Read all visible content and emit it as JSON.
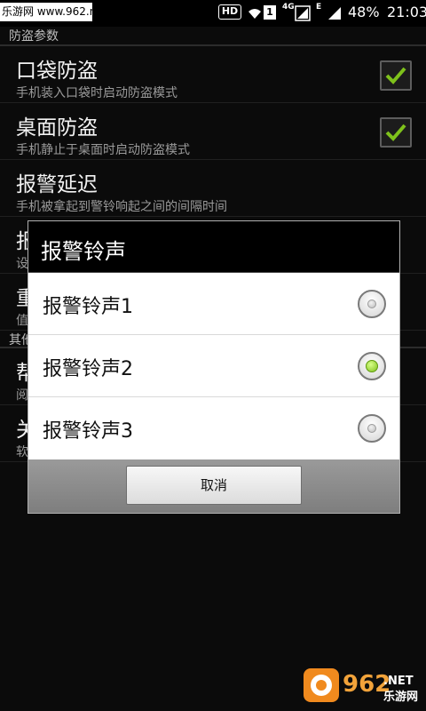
{
  "status_bar": {
    "site": "乐游网 www.962.net",
    "hd": "HD",
    "sim_badge": "1",
    "network_4g": "4G",
    "network_e": "E",
    "battery": "48%",
    "time": "21:03"
  },
  "settings": {
    "section_antitheft": "防盗参数",
    "items": [
      {
        "title": "口袋防盗",
        "summary": "手机装入口袋时启动防盗模式",
        "checked": true
      },
      {
        "title": "桌面防盗",
        "summary": "手机静止于桌面时启动防盗模式",
        "checked": true
      },
      {
        "title": "报警延迟",
        "summary": "手机被拿起到警铃响起之间的间隔时间"
      },
      {
        "title": "报",
        "summary": "设"
      },
      {
        "title": "重",
        "summary": "值"
      }
    ],
    "section_other": "其他",
    "other_items": [
      {
        "title": "帮",
        "summary": "阅"
      },
      {
        "title": "关",
        "summary": "软"
      }
    ]
  },
  "dialog": {
    "title": "报警铃声",
    "options": [
      {
        "label": "报警铃声1",
        "selected": false
      },
      {
        "label": "报警铃声2",
        "selected": true
      },
      {
        "label": "报警铃声3",
        "selected": false
      }
    ],
    "cancel_label": "取消"
  },
  "colors": {
    "accent_green": "#7ec11b",
    "dialog_bg": "#ffffff",
    "title_bar": "#000000"
  },
  "watermark": {
    "numerals": "962",
    "suffix": ".NET",
    "caption": "乐游网"
  }
}
